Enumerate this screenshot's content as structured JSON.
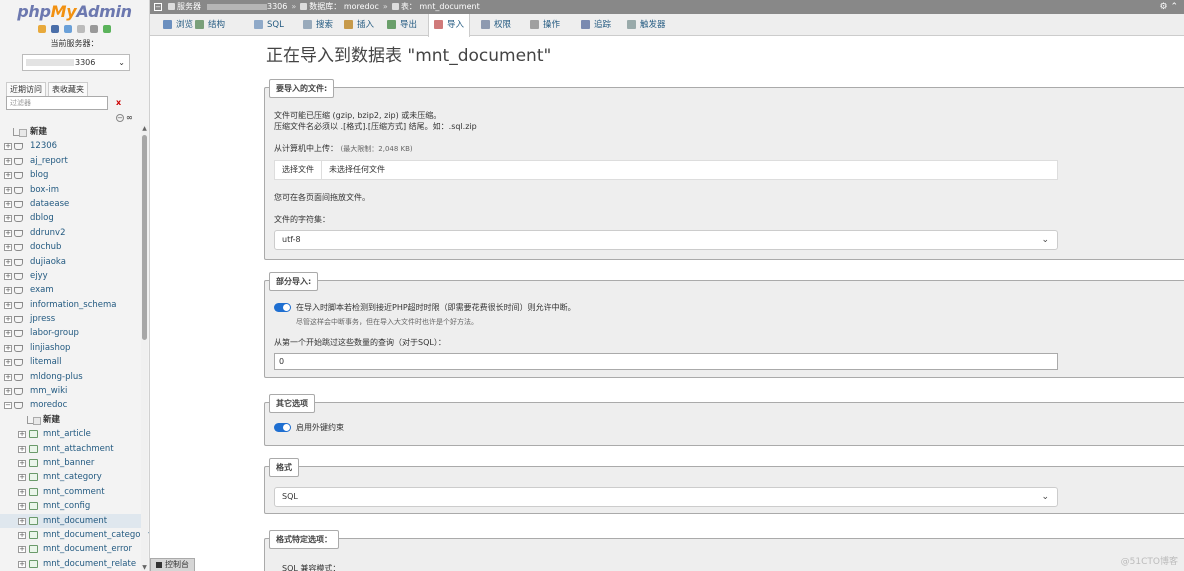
{
  "sidebar": {
    "logo": {
      "php": "php",
      "my": "My",
      "admin": "Admin"
    },
    "server_label": "当前服务器：",
    "server_select_value": "3306",
    "tabs": [
      "近期访问",
      "表收藏夹"
    ],
    "filter_placeholder": "过滤器",
    "filter_clear": "x",
    "collapse_label": "∞",
    "new_label": "新建",
    "databases": [
      "12306",
      "aj_report",
      "blog",
      "box-im",
      "dataease",
      "dblog",
      "ddrunv2",
      "dochub",
      "dujiaoka",
      "ejyy",
      "exam",
      "information_schema",
      "jpress",
      "labor-group",
      "linjiashop",
      "litemall",
      "mldong-plus",
      "mm_wiki",
      "moredoc"
    ],
    "sub_new_label": "新建",
    "tables": [
      "mnt_article",
      "mnt_attachment",
      "mnt_banner",
      "mnt_category",
      "mnt_comment",
      "mnt_config",
      "mnt_document",
      "mnt_document_category",
      "mnt_document_error",
      "mnt_document_relate"
    ],
    "active_table": "mnt_document"
  },
  "topbar": {
    "server_label": "服务器",
    "server_port": "3306",
    "db_label": "数据库：",
    "db_name": "moredoc",
    "table_label": "表：",
    "table_name": "mnt_document",
    "right_icons": "⚙ ⌃"
  },
  "tabs": [
    {
      "label": "浏览",
      "color": "#6b8fbf"
    },
    {
      "label": "结构",
      "color": "#7aa07a"
    },
    {
      "label": "SQL",
      "color": "#8fa9c8"
    },
    {
      "label": "搜索",
      "color": "#9ab"
    },
    {
      "label": "插入",
      "color": "#c79a4b"
    },
    {
      "label": "导出",
      "color": "#6a9f6a"
    },
    {
      "label": "导入",
      "color": "#d07a7a"
    },
    {
      "label": "权限",
      "color": "#8e9ab0"
    },
    {
      "label": "操作",
      "color": "#a0a0a0"
    },
    {
      "label": "追踪",
      "color": "#7a8ab0"
    },
    {
      "label": "触发器",
      "color": "#9aa"
    }
  ],
  "active_tab": "导入",
  "page_title": "正在导入到数据表 \"mnt_document\"",
  "import_file": {
    "legend": "要导入的文件:",
    "compress_line1": "文件可能已压缩 (gzip, bzip2, zip) 或未压缩。",
    "compress_line2": "压缩文件名必须以 .[格式].[压缩方式] 结尾。如：.sql.zip",
    "upload_label": "从计算机中上传：",
    "upload_limit": "(最大限制：2,048 KB)",
    "choose_file_button": "选择文件",
    "no_file_text": "未选择任何文件",
    "drag_hint": "您可在各页面间拖放文件。",
    "charset_label": "文件的字符集：",
    "charset_value": "utf-8"
  },
  "partial_import": {
    "legend": "部分导入:",
    "interrupt_label": "在导入时脚本若检测到接近PHP超时时限（即需要花费很长时间）则允许中断。",
    "interrupt_hint": "尽管这样会中断事务，但在导入大文件时也许是个好方法。",
    "skip_label": "从第一个开始跳过这些数量的查询（对于SQL）：",
    "skip_value": "0"
  },
  "other_options": {
    "legend": "其它选项",
    "foreign_keys_label": "启用外键约束"
  },
  "format": {
    "legend": "格式",
    "value": "SQL"
  },
  "format_specific": {
    "legend": "格式特定选项：",
    "sql_compat_label": "SQL 兼容模式："
  },
  "console_label": "控制台",
  "watermark": "@51CTO博客"
}
